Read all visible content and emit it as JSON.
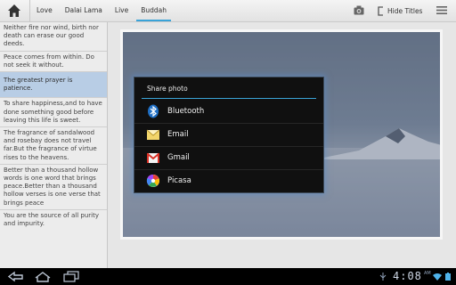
{
  "header": {
    "tabs": [
      {
        "label": "Love",
        "active": false
      },
      {
        "label": "Dalai Lama",
        "active": false
      },
      {
        "label": "Live",
        "active": false
      },
      {
        "label": "Buddah",
        "active": true
      }
    ],
    "hide_titles_label": "Hide Titles"
  },
  "quotes": [
    "Neither fire nor wind, birth nor death can erase our good deeds.",
    "Peace comes from within. Do not seek it without.",
    "The greatest prayer is patience.",
    "To share happiness,and to have done something good before leaving this life is sweet.",
    "The fragrance of sandalwood and rosebay does not travel far.But the fragrance of virtue rises to the heavens.",
    "Better than a thousand hollow words is one word that brings peace.Better than a thousand hollow verses is one verse that brings peace",
    "You are the source of all purity and impurity."
  ],
  "selected_quote_index": 2,
  "dialog": {
    "title": "Share photo",
    "options": [
      {
        "label": "Bluetooth",
        "icon": "bluetooth-icon"
      },
      {
        "label": "Email",
        "icon": "email-icon"
      },
      {
        "label": "Gmail",
        "icon": "gmail-icon"
      },
      {
        "label": "Picasa",
        "icon": "picasa-icon"
      }
    ]
  },
  "status_bar": {
    "time": "4:08",
    "am_pm": "AM"
  },
  "colors": {
    "accent": "#3aa3d8",
    "selected_row": "#b8cde5",
    "dialog_bg": "#101010"
  }
}
